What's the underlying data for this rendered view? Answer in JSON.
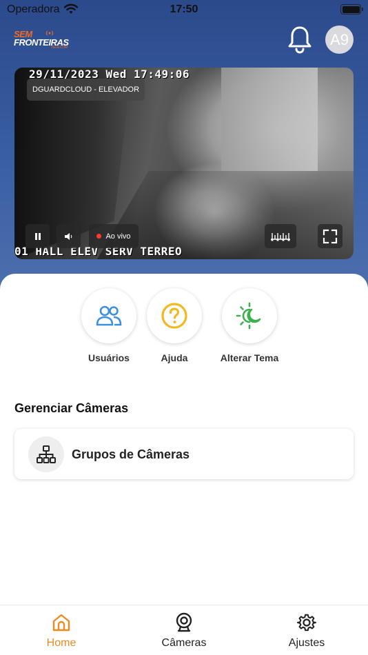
{
  "status_bar": {
    "carrier": "Operadora",
    "time": "17:50"
  },
  "header": {
    "logo": {
      "line1": "SEM",
      "line2": "FRONTEIRAS",
      "tagline": "TELECOM"
    },
    "notifications_icon": "bell-icon",
    "avatar_initials": "A9"
  },
  "video": {
    "timestamp": "29/11/2023 Wed 17:49:06",
    "camera_chip": "DGUARDCLOUD - ELEVADOR",
    "overlay_camera_name": "01 HALL ELEV SERV TERREO",
    "live_label": "Ao vivo",
    "controls": [
      "pause-icon",
      "volume-icon",
      "timeline-icon",
      "fullscreen-icon"
    ]
  },
  "quick_actions": [
    {
      "label": "Usuários",
      "icon": "users-icon",
      "color": "#3b8fe0"
    },
    {
      "label": "Ajuda",
      "icon": "help-icon",
      "color": "#f2b824"
    },
    {
      "label": "Alterar Tema",
      "icon": "theme-icon",
      "color": "#3cb04a"
    }
  ],
  "manage": {
    "section_title": "Gerenciar Câmeras",
    "groups_label": "Grupos de Câmeras"
  },
  "tabs": [
    {
      "label": "Home",
      "icon": "home-icon",
      "active": true
    },
    {
      "label": "Câmeras",
      "icon": "camera-icon",
      "active": false
    },
    {
      "label": "Ajustes",
      "icon": "settings-icon",
      "active": false
    }
  ],
  "colors": {
    "accent": "#ee8a1e",
    "header_bg": "#3a5fa3"
  }
}
